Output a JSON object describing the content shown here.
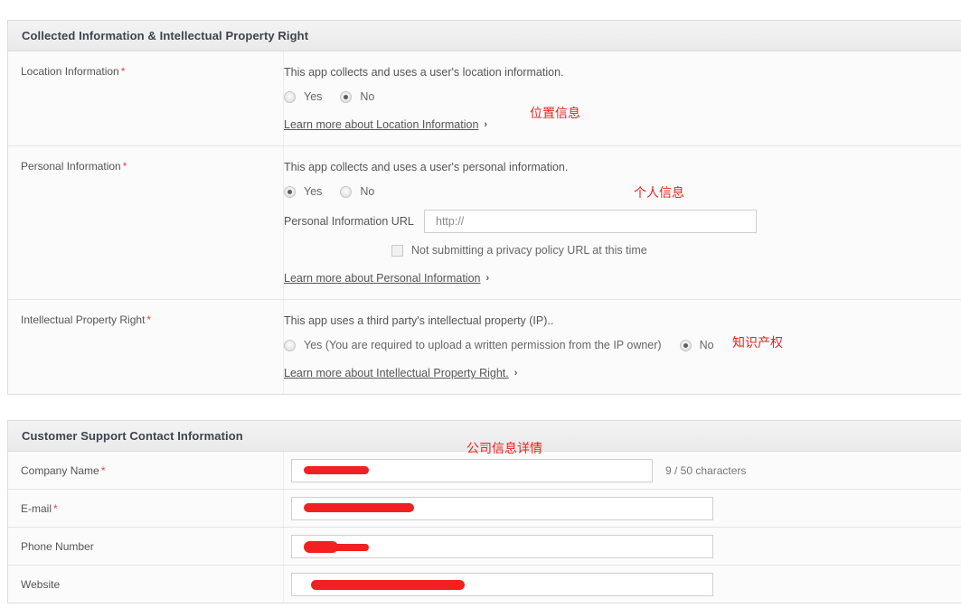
{
  "annotations": {
    "location": "位置信息",
    "personal": "个人信息",
    "ip": "知识产权",
    "company": "公司信息详情",
    "color": "#e8231f"
  },
  "panel_one": {
    "header": "Collected Information & Intellectual Property Right",
    "rows": [
      {
        "label": "Location Information",
        "required_mark": "*",
        "description": "This app collects and uses a user's location information.",
        "options": [
          {
            "label": "Yes",
            "checked": false
          },
          {
            "label": "No",
            "checked": true
          }
        ],
        "learn_more": "Learn more about Location Information",
        "chevron": "›"
      },
      {
        "label": "Personal Information",
        "required_mark": "*",
        "description": "This app collects and uses a user's personal information.",
        "options": [
          {
            "label": "Yes",
            "checked": true
          },
          {
            "label": "No",
            "checked": false
          }
        ],
        "url_label": "Personal Information URL",
        "url_value": "http://",
        "url_placeholder": "http://",
        "checkbox_label": "Not submitting a privacy policy URL at this time",
        "checkbox_checked": false,
        "learn_more": "Learn more about Personal Information",
        "chevron": "›"
      },
      {
        "label": "Intellectual Property Right",
        "required_mark": "*",
        "description": "This app uses a third party's intellectual property (IP)..",
        "options": [
          {
            "label": "Yes (You are required to upload a written permission from the IP owner)",
            "checked": false
          },
          {
            "label": "No",
            "checked": true
          }
        ],
        "learn_more": "Learn more about Intellectual Property Right.",
        "chevron": "›"
      }
    ]
  },
  "panel_two": {
    "header": "Customer Support Contact Information",
    "rows": [
      {
        "label": "Company Name",
        "required_mark": "*",
        "value": "",
        "redacted": true,
        "char_count": "9 / 50 characters"
      },
      {
        "label": "E-mail",
        "required_mark": "*",
        "value": "",
        "redacted": true,
        "char_count": ""
      },
      {
        "label": "Phone Number",
        "required_mark": "",
        "value": "",
        "redacted": true,
        "char_count": ""
      },
      {
        "label": "Website",
        "required_mark": "",
        "value": "",
        "redacted": true,
        "char_count": ""
      }
    ]
  }
}
